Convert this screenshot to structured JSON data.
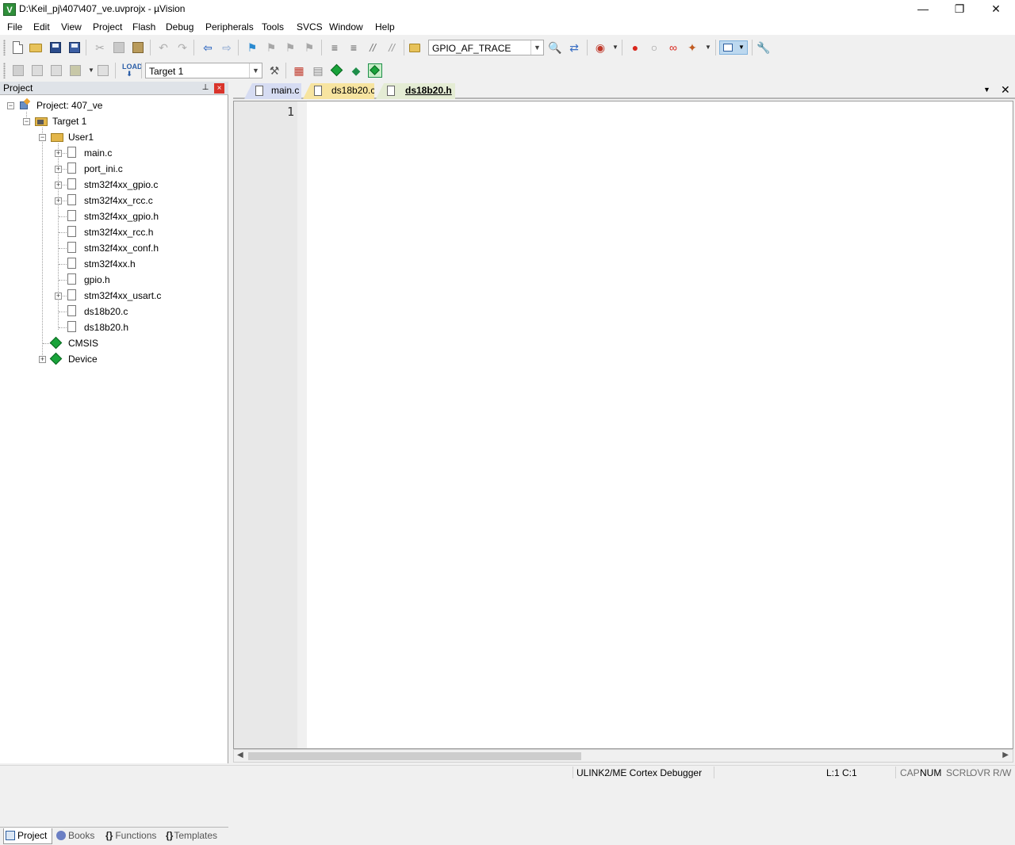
{
  "window": {
    "title": "D:\\Keil_pj\\407\\407_ve.uvprojx - µVision",
    "minimize_glyph": "—",
    "restore_glyph": "❐",
    "close_glyph": "✕"
  },
  "menu": [
    "File",
    "Edit",
    "View",
    "Project",
    "Flash",
    "Debug",
    "Peripherals",
    "Tools",
    "SVCS",
    "Window",
    "Help"
  ],
  "toolbar": {
    "find_combo_value": "GPIO_AF_TRACE",
    "target_combo_value": "Target 1"
  },
  "project_panel": {
    "title": "Project",
    "pin_glyph": "📌",
    "close_glyph": "×",
    "tree": {
      "root": "Project: 407_ve",
      "target": "Target 1",
      "group": "User1",
      "files": [
        "main.c",
        "port_ini.c",
        "stm32f4xx_gpio.c",
        "stm32f4xx_rcc.c",
        "stm32f4xx_gpio.h",
        "stm32f4xx_rcc.h",
        "stm32f4xx_conf.h",
        "stm32f4xx.h",
        "gpio.h",
        "stm32f4xx_usart.c",
        "ds18b20.c",
        "ds18b20.h"
      ],
      "cmsis": "CMSIS",
      "device": "Device"
    },
    "tabs": {
      "project": "Project",
      "books": "Books",
      "functions": "Functions",
      "templates": "Templates"
    }
  },
  "editor": {
    "tabs": {
      "main": "main.c",
      "ds18b20_c": "ds18b20.c",
      "ds18b20_h": "ds18b20.h"
    },
    "active_tab": "ds18b20.h",
    "line_number": "1",
    "tab_menu_glyph": "▼",
    "tab_close_glyph": "✕"
  },
  "status": {
    "debugger": "ULINK2/ME Cortex Debugger",
    "position": "L:1 C:1",
    "cap": "CAP",
    "num": "NUM",
    "scrl": "SCRL",
    "ovr": "OVR",
    "rw": "R/W"
  },
  "colors": {
    "tab_main_bg": "#d6dcf2",
    "tab_ds18b20_c_bg": "#f7e4a0",
    "tab_active_bg": "#e4ecd4",
    "panel_close": "#d9342b",
    "diamond": "#19a33a"
  }
}
